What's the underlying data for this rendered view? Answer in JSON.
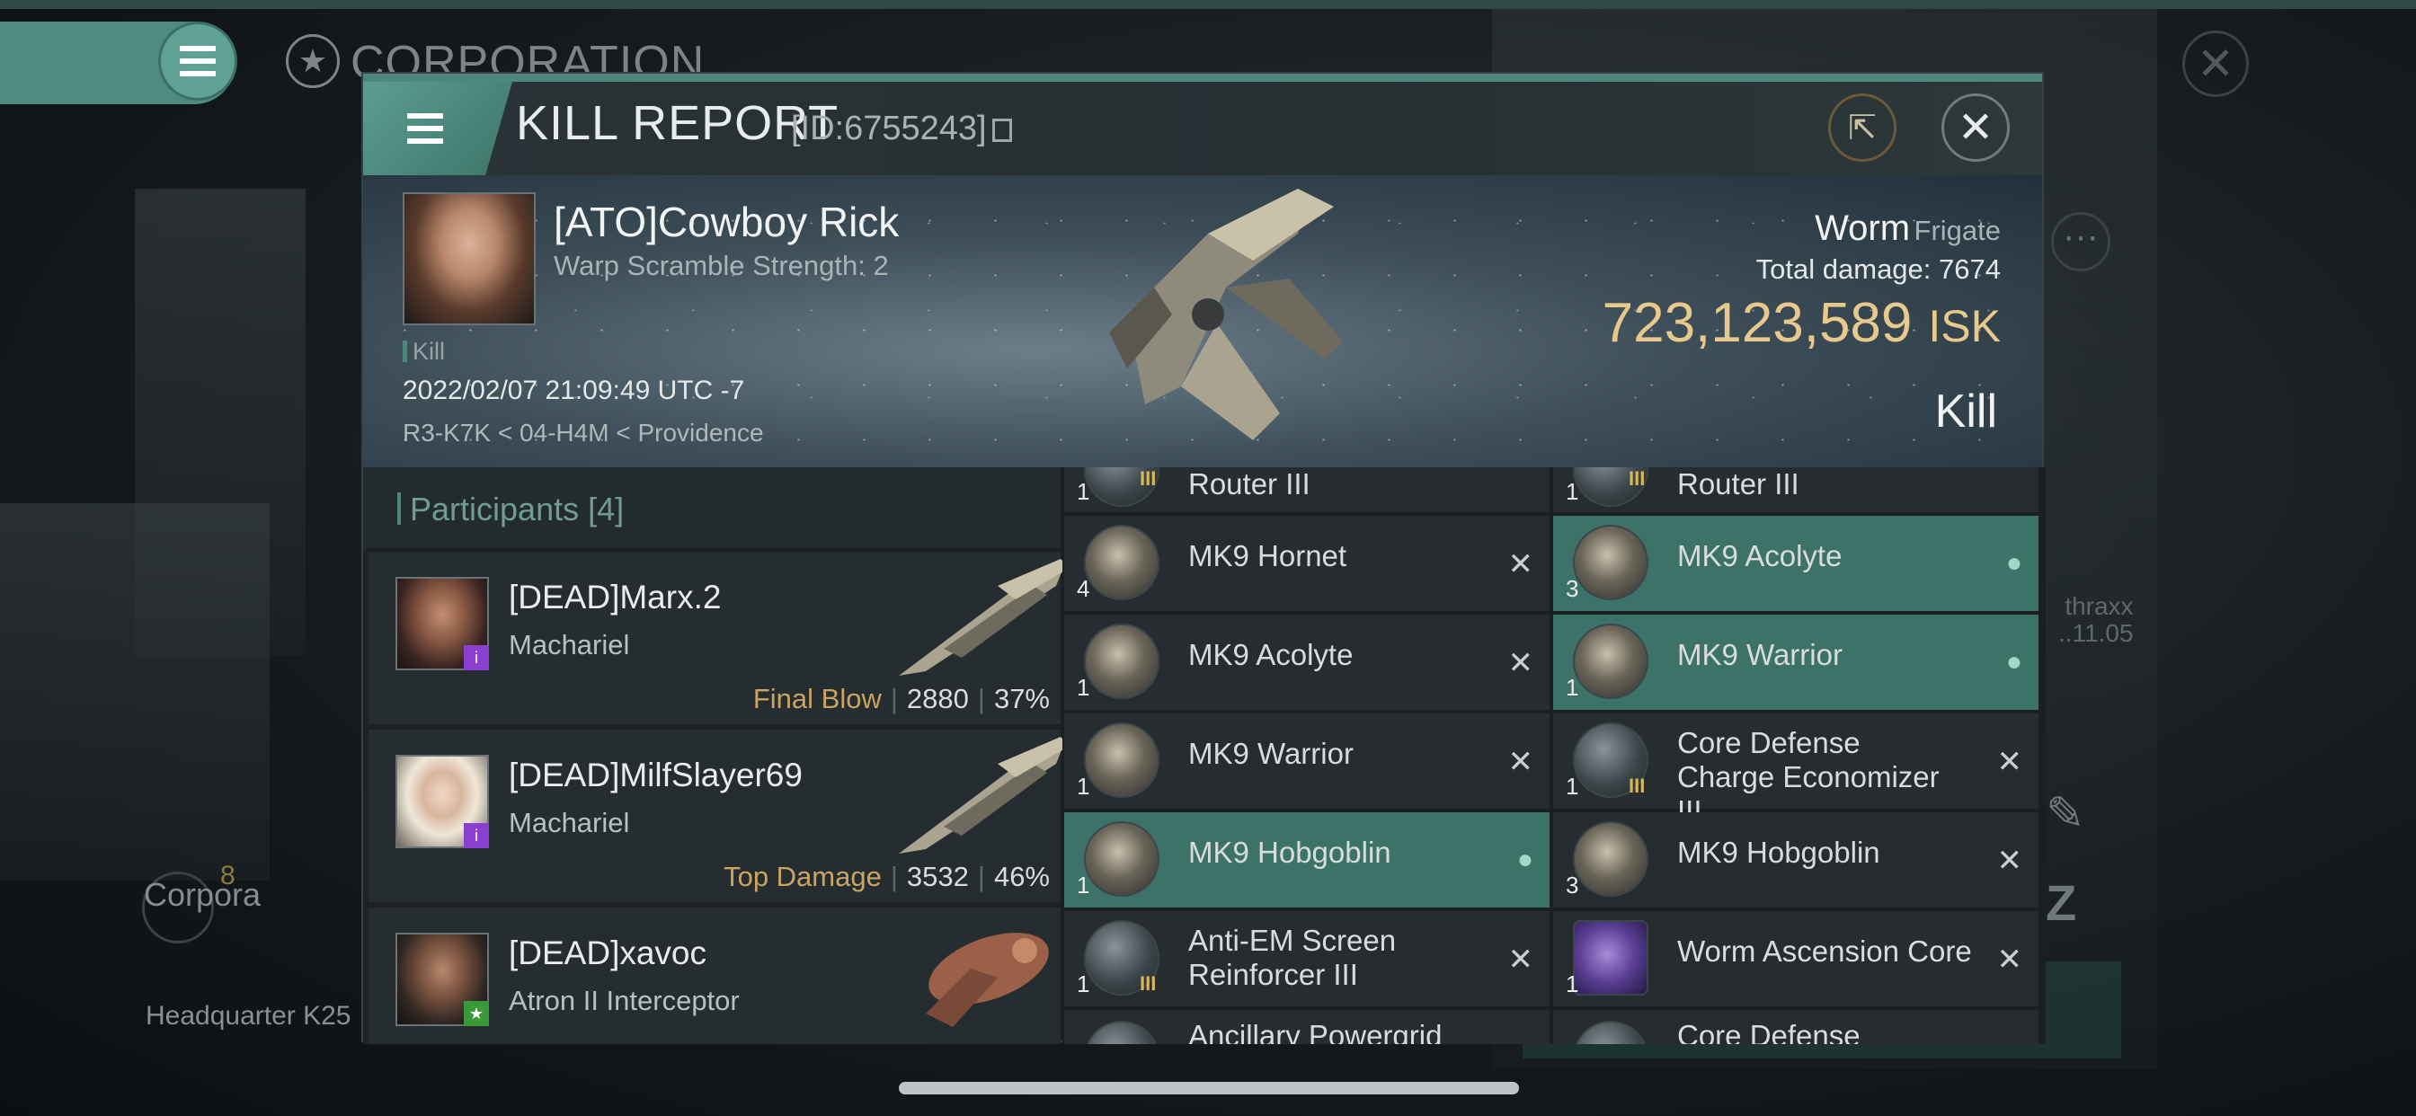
{
  "background": {
    "title": "CORPORATION",
    "corp_label": "Corpora",
    "corp_count": "8",
    "hq_label": "Headquarter K25",
    "side_text": [
      "thraxx",
      "..11.05"
    ]
  },
  "report": {
    "title": "KILL REPORT",
    "id_text": "[ID:6755243]"
  },
  "victim": {
    "name": "[ATO]Cowboy Rick",
    "scram": "Warp Scramble Strength: 2",
    "kill_tag": "Kill",
    "datetime": "2022/02/07 21:09:49 UTC -7",
    "location": "R3-K7K < 04-H4M < Providence",
    "ship_name": "Worm",
    "ship_class": "Frigate",
    "total_damage_label": "Total damage:",
    "total_damage": "7674",
    "isk_value": "723,123,589",
    "isk_unit": "ISK",
    "result": "Kill"
  },
  "participants": {
    "label": "Participants",
    "count": "[4]",
    "list": [
      {
        "name": "[DEAD]Marx.2",
        "ship": "Machariel",
        "tag": "Final Blow",
        "damage": "2880",
        "percent": "37%"
      },
      {
        "name": "[DEAD]MilfSlayer69",
        "ship": "Machariel",
        "tag": "Top Damage",
        "damage": "3532",
        "percent": "46%"
      },
      {
        "name": "[DEAD]xavoc",
        "ship": "Atron II Interceptor",
        "tag": "",
        "damage": "",
        "percent": ""
      }
    ]
  },
  "fitting": {
    "left": [
      {
        "qty": "1",
        "name": "Router III",
        "meta": "III",
        "action": ""
      },
      {
        "qty": "4",
        "name": "MK9  Hornet",
        "meta": "",
        "action": "✕"
      },
      {
        "qty": "1",
        "name": "MK9  Acolyte",
        "meta": "",
        "action": "✕"
      },
      {
        "qty": "1",
        "name": "MK9  Warrior",
        "meta": "",
        "action": "✕"
      },
      {
        "qty": "1",
        "name": "MK9  Hobgoblin",
        "meta": "",
        "action": "person"
      },
      {
        "qty": "1",
        "name": "Anti-EM Screen Reinforcer III",
        "meta": "III",
        "action": "✕"
      },
      {
        "qty": "",
        "name": "Ancillary Powergrid",
        "meta": "",
        "action": ""
      }
    ],
    "right": [
      {
        "qty": "1",
        "name": "Router III",
        "meta": "III",
        "action": ""
      },
      {
        "qty": "3",
        "name": "MK9  Acolyte",
        "meta": "",
        "action": "person"
      },
      {
        "qty": "1",
        "name": "MK9  Warrior",
        "meta": "",
        "action": "person"
      },
      {
        "qty": "1",
        "name": "Core Defense Charge Economizer III",
        "meta": "III",
        "action": "✕"
      },
      {
        "qty": "3",
        "name": "MK9  Hobgoblin",
        "meta": "",
        "action": "✕"
      },
      {
        "qty": "1",
        "name": "Worm Ascension Core",
        "meta": "",
        "action": "✕"
      },
      {
        "qty": "",
        "name": "Core Defense",
        "meta": "",
        "action": ""
      }
    ]
  },
  "colors": {
    "accent": "#4d877d",
    "isk": "#e8c98c",
    "highlight": "#3d7269",
    "tag": "#c9a463"
  }
}
